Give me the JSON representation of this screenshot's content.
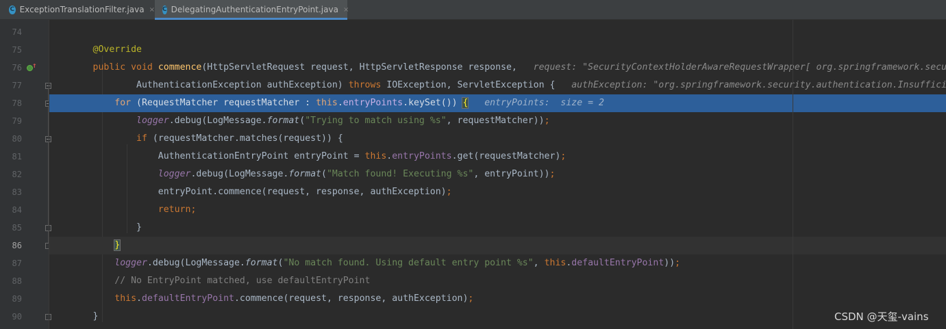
{
  "tabs": [
    {
      "label": "ExceptionTranslationFilter.java",
      "icon": "class-icon",
      "icon_letter": "C",
      "close": "×",
      "active": false
    },
    {
      "label": "DelegatingAuthenticationEntryPoint.java",
      "icon": "class-icon",
      "icon_letter": "C",
      "close": "×",
      "active": true
    }
  ],
  "gutter": {
    "line_numbers": [
      "74",
      "75",
      "76",
      "77",
      "78",
      "79",
      "80",
      "81",
      "82",
      "83",
      "84",
      "85",
      "86",
      "87",
      "88",
      "89",
      "90"
    ],
    "current_line": "86",
    "execution_line": "78",
    "override_marker_line": "76",
    "override_marker_icon": "override-method-icon",
    "override_arrow": "↑"
  },
  "colors": {
    "background": "#2b2b2b",
    "keyword": "#cc7832",
    "annotation": "#bbb529",
    "method_decl": "#ffc66d",
    "field": "#9876aa",
    "string": "#6a8759",
    "comment": "#808080",
    "execution_highlight": "#2d5f9a"
  },
  "code": {
    "l75": {
      "annotation": "@Override"
    },
    "l76": {
      "kw": "public void ",
      "method": "commence",
      "params": "(HttpServletRequest request, HttpServletResponse response,",
      "hint": "   request: \"SecurityContextHolderAwareRequestWrapper[ org.springframework.security.web.servletapi.HttpServlet3RequestFactory"
    },
    "l77": {
      "a": "AuthenticationException authException) ",
      "throws": "throws",
      "b": " IOException, ServletException {",
      "hint": "   authException: \"org.springframework.security.authentication.InsufficientAuthenticationException: Full authentication"
    },
    "l78": {
      "kw_for": "for",
      "a": " (RequestMatcher requestMatcher : ",
      "kw_this": "this",
      "dot": ".",
      "field": "entryPoints",
      "b": ".keySet()) ",
      "brace": "{",
      "hint": "   entryPoints:  size = 2"
    },
    "l79": {
      "logger": "logger",
      "a": ".debug(LogMessage.",
      "format": "format",
      "b": "(",
      "str": "\"Trying to match using %s\"",
      "c": ", requestMatcher))",
      "semi": ";"
    },
    "l80": {
      "kw_if": "if",
      "a": " (requestMatcher.matches(request)) {"
    },
    "l81": {
      "a": "AuthenticationEntryPoint entryPoint = ",
      "kw_this": "this",
      "dot": ".",
      "field": "entryPoints",
      "b": ".get(requestMatcher)",
      "semi": ";"
    },
    "l82": {
      "logger": "logger",
      "a": ".debug(LogMessage.",
      "format": "format",
      "b": "(",
      "str": "\"Match found! Executing %s\"",
      "c": ", entryPoint))",
      "semi": ";"
    },
    "l83": {
      "a": "entryPoint.commence(request, response, authException)",
      "semi": ";"
    },
    "l84": {
      "kw_return": "return",
      "semi": ";"
    },
    "l85": {
      "brace": "}"
    },
    "l86": {
      "brace": "}"
    },
    "l87": {
      "logger": "logger",
      "a": ".debug(LogMessage.",
      "format": "format",
      "b": "(",
      "str": "\"No match found. Using default entry point %s\"",
      "c": ", ",
      "kw_this": "this",
      "dot": ".",
      "field": "defaultEntryPoint",
      "d": "))",
      "semi": ";"
    },
    "l88": {
      "comment": "// No EntryPoint matched, use defaultEntryPoint"
    },
    "l89": {
      "kw_this": "this",
      "dot": ".",
      "field": "defaultEntryPoint",
      "a": ".commence(request, response, authException)",
      "semi": ";"
    },
    "l90": {
      "brace": "}"
    }
  },
  "watermark": "CSDN @天玺-vains"
}
